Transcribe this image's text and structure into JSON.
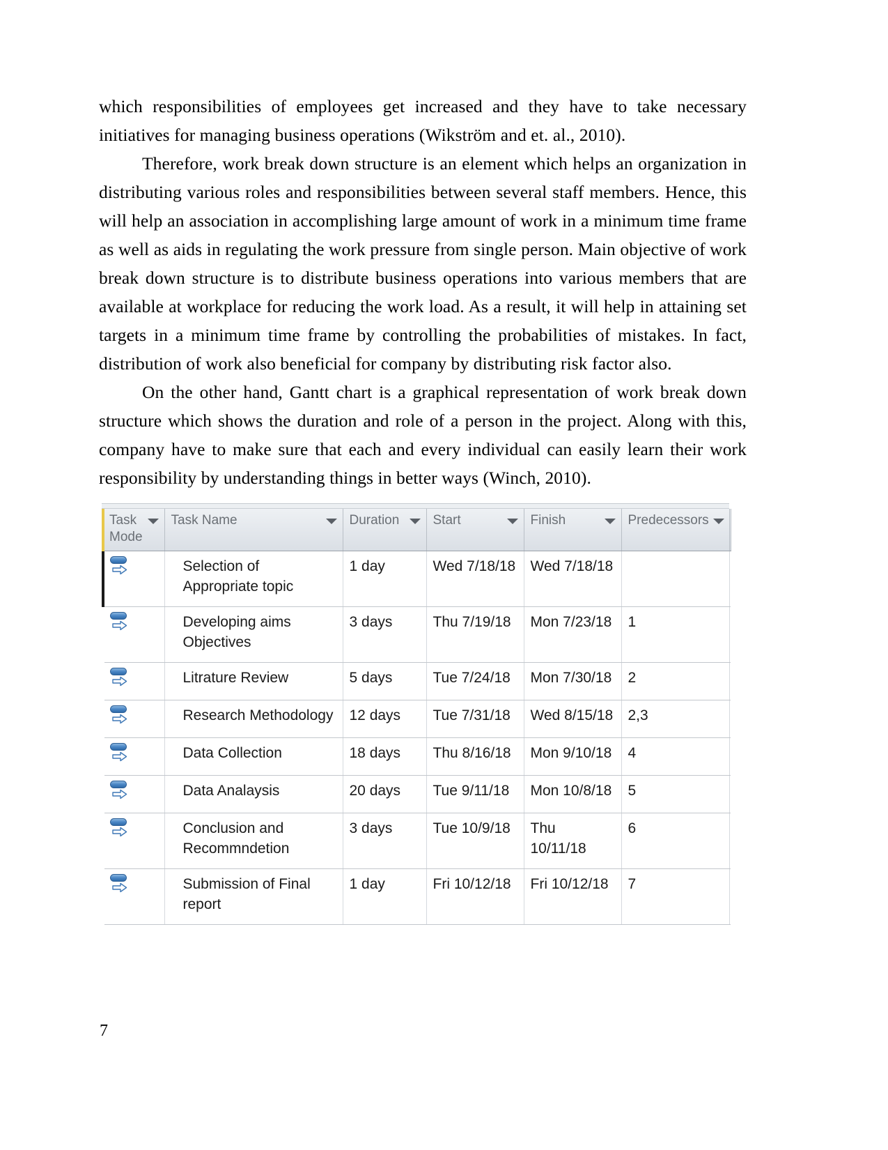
{
  "document": {
    "page_number": "7",
    "paragraphs": [
      "which responsibilities of employees get increased and they have to take necessary initiatives for managing business operations (Wikström and et. al., 2010).",
      "Therefore, work break down structure is an element which helps an organization in distributing various roles and responsibilities between several staff members. Hence, this will help an association in accomplishing large amount of work in a minimum time frame as well as aids in regulating the work pressure from single person. Main objective of work break down structure is to distribute business operations into various members that are available at workplace for reducing the work load. As a result, it will help in attaining set targets in a minimum time frame by controlling the probabilities of mistakes. In fact, distribution of work also beneficial for company by distributing risk factor also.",
      "On the other hand, Gantt chart is a graphical representation of work break down structure which shows the duration and role of a person in the project. Along with this, company have to make sure that each and every individual can easily learn their work responsibility by understanding things in better ways (Winch, 2010)."
    ]
  },
  "project_table": {
    "columns": [
      {
        "label": "Task Mode",
        "has_filter": true
      },
      {
        "label": "Task Name",
        "has_filter": true
      },
      {
        "label": "Duration",
        "has_filter": true
      },
      {
        "label": "Start",
        "has_filter": true
      },
      {
        "label": "Finish",
        "has_filter": true
      },
      {
        "label": "Predecessors",
        "has_filter": true
      }
    ],
    "task_mode_icon": "auto-scheduled-icon",
    "accent_colors": {
      "mode_column_marker": "#e8c84a",
      "selected_row_marker": "#1b1b1b",
      "header_background": "#e3e7ec",
      "header_text": "#6b7076",
      "icon_blue": "#4a86c5"
    },
    "rows": [
      {
        "task_mode": "Auto Scheduled",
        "task_name": "Selection of Appropriate topic",
        "duration": "1 day",
        "start": "Wed 7/18/18",
        "finish": "Wed 7/18/18",
        "predecessors": "",
        "selected": true,
        "tall": true
      },
      {
        "task_mode": "Auto Scheduled",
        "task_name": "Developing aims Objectives",
        "duration": "3 days",
        "start": "Thu 7/19/18",
        "finish": "Mon 7/23/18",
        "predecessors": "1",
        "selected": false,
        "tall": true
      },
      {
        "task_mode": "Auto Scheduled",
        "task_name": "Litrature Review",
        "duration": "5 days",
        "start": "Tue 7/24/18",
        "finish": "Mon 7/30/18",
        "predecessors": "2",
        "selected": false,
        "tall": false
      },
      {
        "task_mode": "Auto Scheduled",
        "task_name": "Research Methodology",
        "duration": "12 days",
        "start": "Tue 7/31/18",
        "finish": "Wed 8/15/18",
        "predecessors": "2,3",
        "selected": false,
        "tall": false
      },
      {
        "task_mode": "Auto Scheduled",
        "task_name": "Data Collection",
        "duration": "18 days",
        "start": "Thu 8/16/18",
        "finish": "Mon 9/10/18",
        "predecessors": "4",
        "selected": false,
        "tall": false
      },
      {
        "task_mode": "Auto Scheduled",
        "task_name": "Data Analaysis",
        "duration": "20 days",
        "start": "Tue 9/11/18",
        "finish": "Mon 10/8/18",
        "predecessors": "5",
        "selected": false,
        "tall": false
      },
      {
        "task_mode": "Auto Scheduled",
        "task_name": "Conclusion and Recommndetion",
        "duration": "3 days",
        "start": "Tue 10/9/18",
        "finish": "Thu 10/11/18",
        "predecessors": "6",
        "selected": false,
        "tall": true
      },
      {
        "task_mode": "Auto Scheduled",
        "task_name": "Submission of Final report",
        "duration": "1 day",
        "start": "Fri 10/12/18",
        "finish": "Fri 10/12/18",
        "predecessors": "7",
        "selected": false,
        "tall": true
      }
    ]
  }
}
